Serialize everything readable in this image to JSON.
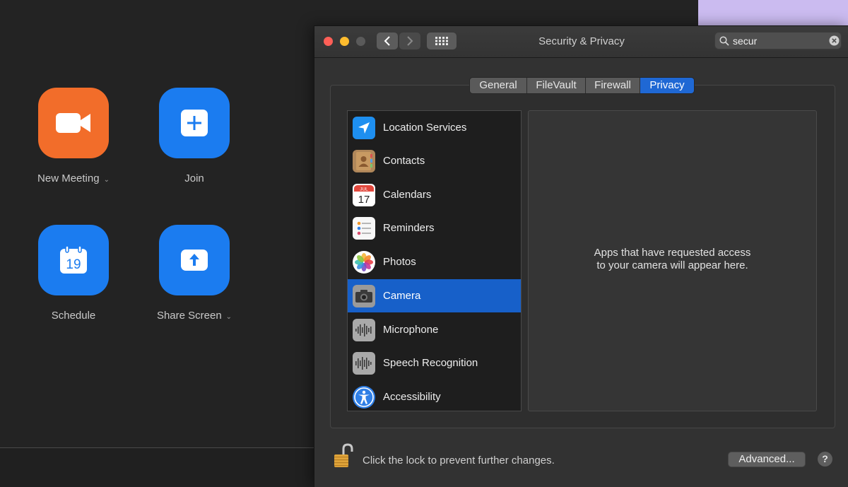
{
  "zoom": {
    "buttons": [
      {
        "label": "New Meeting",
        "has_dropdown": true,
        "color": "#f26d2a",
        "icon": "video-camera-icon"
      },
      {
        "label": "Join",
        "has_dropdown": false,
        "color": "#1b7cf0",
        "icon": "plus-icon"
      },
      {
        "label": "Schedule",
        "has_dropdown": false,
        "color": "#1b7cf0",
        "icon": "calendar-icon",
        "icon_text": "19"
      },
      {
        "label": "Share Screen",
        "has_dropdown": true,
        "color": "#1b7cf0",
        "icon": "share-up-arrow-icon"
      }
    ]
  },
  "window": {
    "title": "Security & Privacy",
    "search": {
      "value": "secur"
    },
    "tabs": [
      {
        "label": "General",
        "active": false
      },
      {
        "label": "FileVault",
        "active": false
      },
      {
        "label": "Firewall",
        "active": false
      },
      {
        "label": "Privacy",
        "active": true
      }
    ],
    "privacy_list": [
      {
        "label": "Location Services",
        "icon": "location-arrow-icon",
        "selected": false
      },
      {
        "label": "Contacts",
        "icon": "contacts-book-icon",
        "selected": false
      },
      {
        "label": "Calendars",
        "icon": "calendar-icon",
        "icon_month": "JUL",
        "icon_day": "17",
        "selected": false
      },
      {
        "label": "Reminders",
        "icon": "reminders-list-icon",
        "selected": false
      },
      {
        "label": "Photos",
        "icon": "photos-flower-icon",
        "selected": false
      },
      {
        "label": "Camera",
        "icon": "camera-icon",
        "selected": true
      },
      {
        "label": "Microphone",
        "icon": "microphone-waveform-icon",
        "selected": false
      },
      {
        "label": "Speech Recognition",
        "icon": "speech-waveform-icon",
        "selected": false
      },
      {
        "label": "Accessibility",
        "icon": "accessibility-person-icon",
        "selected": false
      }
    ],
    "detail_message_line1": "Apps that have requested access",
    "detail_message_line2": "to your camera will appear here.",
    "lock_message": "Click the lock to prevent further changes.",
    "advanced_label": "Advanced...",
    "help_label": "?"
  },
  "colors": {
    "selection": "#1760c9",
    "tab_active": "#1f68d4",
    "zoom_orange": "#f26d2a",
    "zoom_blue": "#1b7cf0"
  }
}
